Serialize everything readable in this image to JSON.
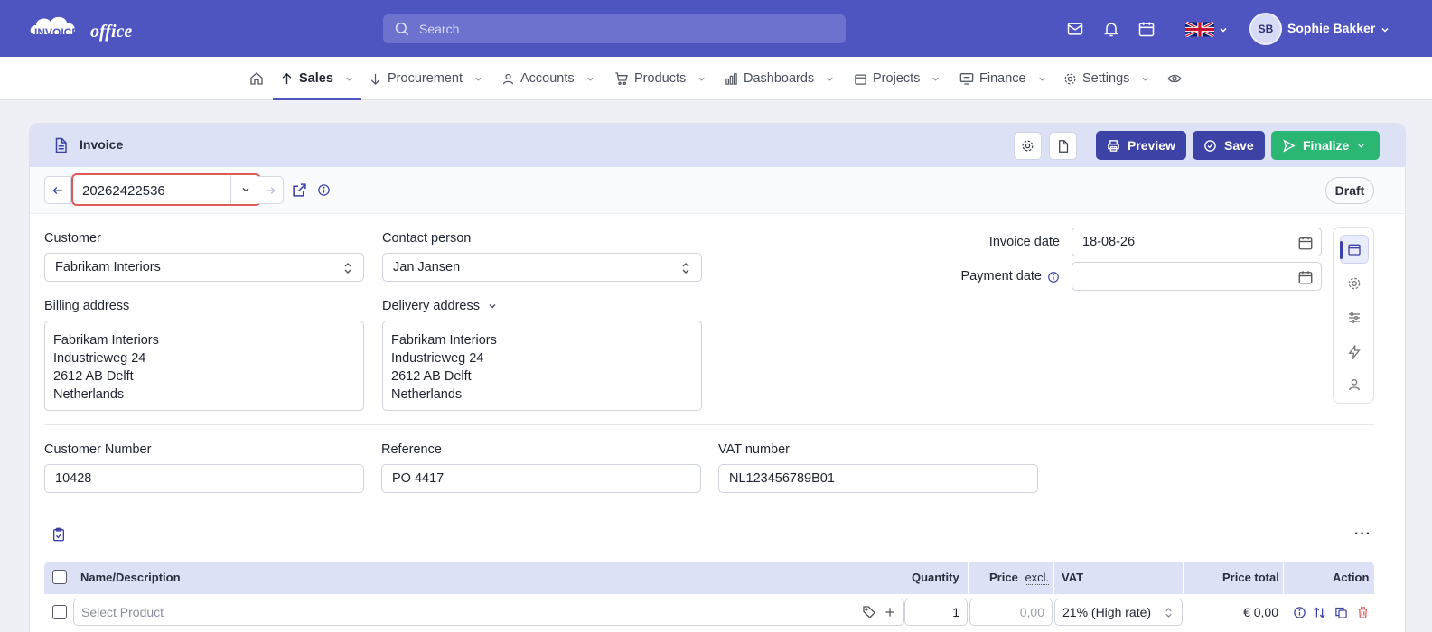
{
  "topbar": {
    "logo_left": "INVOICE",
    "logo_right": "office",
    "search_placeholder": "Search",
    "user_initials": "SB",
    "user_name": "Sophie Bakker"
  },
  "nav": {
    "items": [
      {
        "label": "Sales",
        "active": true
      },
      {
        "label": "Procurement"
      },
      {
        "label": "Accounts"
      },
      {
        "label": "Products"
      },
      {
        "label": "Dashboards"
      },
      {
        "label": "Projects"
      },
      {
        "label": "Finance"
      },
      {
        "label": "Settings"
      }
    ]
  },
  "invoice": {
    "title": "Invoice",
    "buttons": {
      "preview": "Preview",
      "save": "Save",
      "finalize": "Finalize"
    },
    "number": "20262422536",
    "status": "Draft",
    "customer_label": "Customer",
    "customer_value": "Fabrikam Interiors",
    "contact_label": "Contact person",
    "contact_value": "Jan Jansen",
    "invoice_date_label": "Invoice date",
    "invoice_date_value": "18-08-26",
    "payment_date_label": "Payment date",
    "payment_date_value": "",
    "billing_label": "Billing address",
    "billing_lines": [
      "Fabrikam Interiors",
      "Industrieweg 24",
      "2612 AB Delft",
      "Netherlands"
    ],
    "delivery_label": "Delivery address",
    "delivery_lines": [
      "Fabrikam Interiors",
      "Industrieweg 24",
      "2612 AB Delft",
      "Netherlands"
    ],
    "customer_number_label": "Customer Number",
    "customer_number_value": "10428",
    "reference_label": "Reference",
    "reference_value": "PO 4417",
    "vat_number_label": "VAT number",
    "vat_number_value": "NL123456789B01"
  },
  "table": {
    "headers": {
      "name": "Name/Description",
      "quantity": "Quantity",
      "price": "Price",
      "price_suffix": "excl.",
      "vat": "VAT",
      "price_total": "Price total",
      "action": "Action"
    },
    "row": {
      "product_placeholder": "Select Product",
      "quantity": "1",
      "price_placeholder": "0,00",
      "vat": "21% (High rate)",
      "total": "€ 0,00"
    }
  },
  "colors": {
    "topbar": "#4f55c0",
    "primary_button": "#3d42a6",
    "finalize_button": "#2bb673",
    "header_band": "#dde1f6",
    "highlight_border": "#e05a5a"
  }
}
